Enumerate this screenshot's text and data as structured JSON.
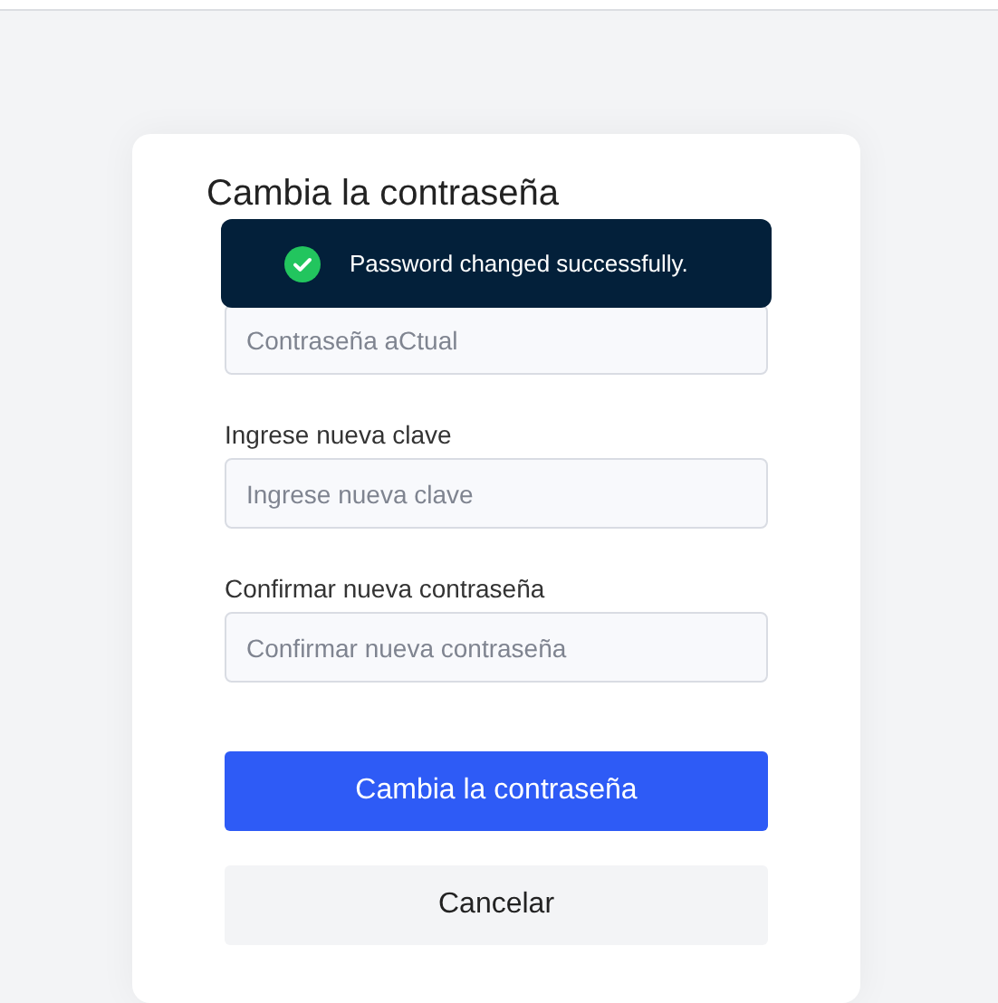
{
  "title": "Cambia la contraseña",
  "toast": {
    "kind": "success",
    "message": "Password changed successfully."
  },
  "fields": [
    {
      "placeholder": "Contraseña aCtual"
    },
    {
      "label": "Ingrese nueva clave",
      "placeholder": "Ingrese nueva clave"
    },
    {
      "label": "Confirmar nueva contraseña",
      "placeholder": "Confirmar nueva contraseña"
    }
  ],
  "buttons": [
    {
      "kind": "primary",
      "label": "Cambia la contraseña"
    },
    {
      "kind": "secondary",
      "label": "Cancelar"
    }
  ]
}
